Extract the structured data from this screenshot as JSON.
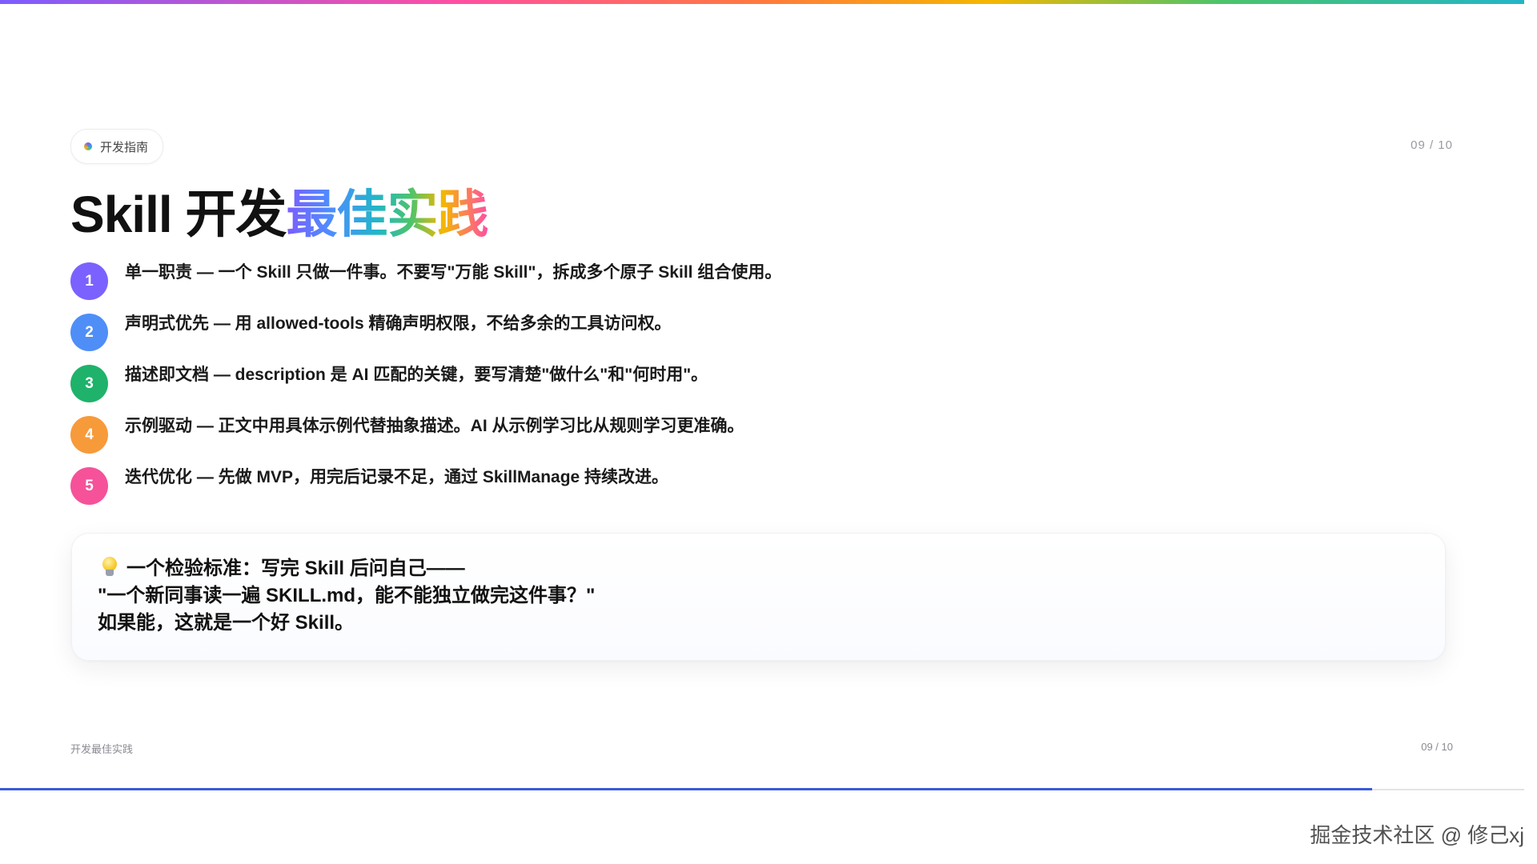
{
  "tag": {
    "label": "开发指南"
  },
  "page_indicator": "09  /  10",
  "title": {
    "plain": "Skill 开发",
    "highlight": "最佳实践"
  },
  "practices": [
    {
      "number": "1",
      "color": "#7b61ff",
      "text": "单一职责 — 一个 Skill 只做一件事。不要写\"万能 Skill\"，拆成多个原子 Skill 组合使用。"
    },
    {
      "number": "2",
      "color": "#4f8ef7",
      "text": "声明式优先 — 用 allowed-tools 精确声明权限，不给多余的工具访问权。"
    },
    {
      "number": "3",
      "color": "#1fb26b",
      "text": "描述即文档 — description 是 AI 匹配的关键，要写清楚\"做什么\"和\"何时用\"。"
    },
    {
      "number": "4",
      "color": "#f79a3a",
      "text": "示例驱动 — 正文中用具体示例代替抽象描述。AI 从示例学习比从规则学习更准确。"
    },
    {
      "number": "5",
      "color": "#f5529a",
      "text": "迭代优化 — 先做 MVP，用完后记录不足，通过 SkillManage 持续改进。"
    }
  ],
  "tip": {
    "icon": "lightbulb-icon",
    "line1": "一个检验标准：写完 Skill 后问自己——",
    "line2": "\"一个新同事读一遍 SKILL.md，能不能独立做完这件事？\"",
    "line3": "如果能，这就是一个好 Skill。"
  },
  "footer": {
    "left": "开发最佳实践",
    "right": "09 / 10"
  },
  "progress": {
    "fraction": 0.9
  },
  "watermark": "掘金技术社区 @ 修己xj"
}
